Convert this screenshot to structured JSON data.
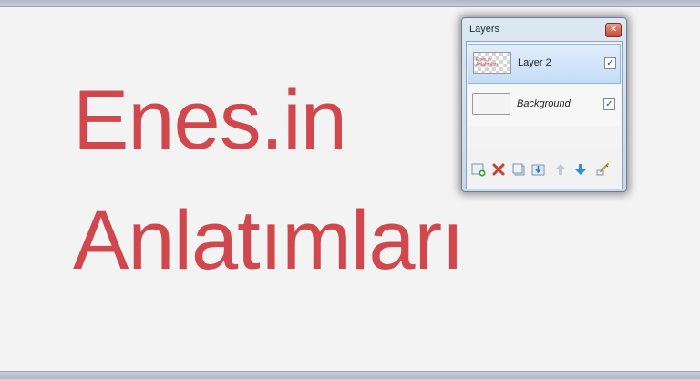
{
  "canvas": {
    "line1": "Enes.in",
    "line2": "Anlatımları",
    "text_color": "#d0484d"
  },
  "layers_panel": {
    "title": "Layers",
    "layers": [
      {
        "name": "Layer 2",
        "visible": true,
        "selected": true,
        "thumb_text": "Enes.in Anlatımları"
      },
      {
        "name": "Background",
        "visible": true,
        "selected": false
      }
    ],
    "toolbar_icons": [
      "add-layer-icon",
      "delete-layer-icon",
      "duplicate-layer-icon",
      "merge-layer-down-icon",
      "move-layer-up-icon",
      "move-layer-down-icon",
      "layer-properties-icon"
    ]
  }
}
